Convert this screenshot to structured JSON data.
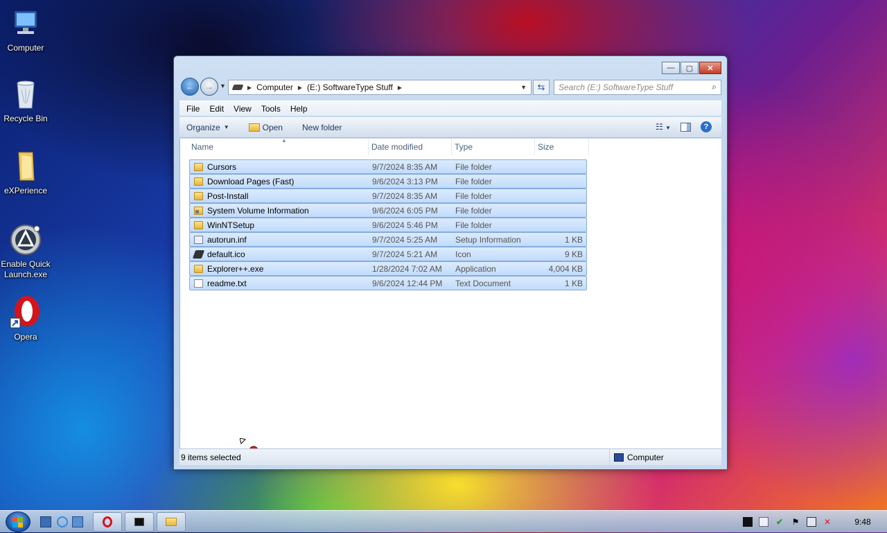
{
  "desktop": {
    "icons": [
      {
        "label": "Computer"
      },
      {
        "label": "Recycle Bin"
      },
      {
        "label": "eXPerience"
      },
      {
        "label": "Enable Quick Launch.exe"
      },
      {
        "label": "Opera"
      }
    ]
  },
  "window": {
    "controls": {
      "minimize": "—",
      "maximize": "▢",
      "close": "✕"
    },
    "address": {
      "crumbs": [
        "Computer",
        "(E:) SoftwareType Stuff"
      ]
    },
    "search": {
      "placeholder": "Search (E:) SoftwareType Stuff"
    },
    "menu": [
      "File",
      "Edit",
      "View",
      "Tools",
      "Help"
    ],
    "toolbar": {
      "organize": "Organize",
      "open": "Open",
      "new_folder": "New folder"
    },
    "columns": {
      "name": "Name",
      "date": "Date modified",
      "type": "Type",
      "size": "Size"
    },
    "files": [
      {
        "name": "Cursors",
        "date": "9/7/2024 8:35 AM",
        "type": "File folder",
        "size": "",
        "icon": "folder-icon"
      },
      {
        "name": "Download Pages (Fast)",
        "date": "9/6/2024 3:13 PM",
        "type": "File folder",
        "size": "",
        "icon": "folder-icon"
      },
      {
        "name": "Post-Install",
        "date": "9/7/2024 8:35 AM",
        "type": "File folder",
        "size": "",
        "icon": "folder-icon"
      },
      {
        "name": "System Volume Information",
        "date": "9/6/2024 6:05 PM",
        "type": "File folder",
        "size": "",
        "icon": "locked-folder-icon"
      },
      {
        "name": "WinNTSetup",
        "date": "9/6/2024 5:46 PM",
        "type": "File folder",
        "size": "",
        "icon": "folder-icon"
      },
      {
        "name": "autorun.inf",
        "date": "9/7/2024 5:25 AM",
        "type": "Setup Information",
        "size": "1 KB",
        "icon": "setup-file-icon"
      },
      {
        "name": "default.ico",
        "date": "9/7/2024 5:21 AM",
        "type": "Icon",
        "size": "9 KB",
        "icon": "ico-file-icon"
      },
      {
        "name": "Explorer++.exe",
        "date": "1/28/2024 7:02 AM",
        "type": "Application",
        "size": "4,004 KB",
        "icon": "folder-app-icon"
      },
      {
        "name": "readme.txt",
        "date": "9/6/2024 12:44 PM",
        "type": "Text Document",
        "size": "1 KB",
        "icon": "text-file-icon"
      }
    ],
    "status": {
      "selected": "9 items selected",
      "location": "Computer"
    }
  },
  "taskbar": {
    "clock": "9:48"
  }
}
